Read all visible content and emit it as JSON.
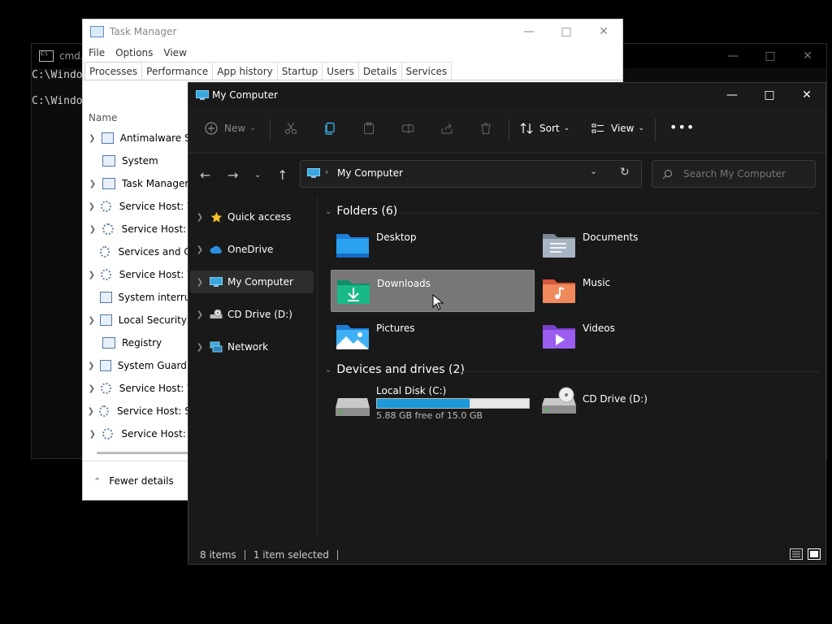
{
  "cmd": {
    "title": "cmd.e",
    "lines": [
      "C:\\Windo",
      "C:\\Windo"
    ]
  },
  "taskmgr": {
    "title": "Task Manager",
    "menu": [
      "File",
      "Options",
      "View"
    ],
    "tabs": [
      "Processes",
      "Performance",
      "App history",
      "Startup",
      "Users",
      "Details",
      "Services"
    ],
    "active_tab": "Processes",
    "column_name": "Name",
    "processes": [
      {
        "name": "Antimalware Se",
        "expand": true,
        "icon": "app-icon"
      },
      {
        "name": "System",
        "expand": false,
        "icon": "app-icon"
      },
      {
        "name": "Task Manager",
        "expand": true,
        "icon": "taskmgr-icon"
      },
      {
        "name": "Service Host: W",
        "expand": true,
        "icon": "gear-icon"
      },
      {
        "name": "Service Host: N",
        "expand": true,
        "icon": "gear-icon"
      },
      {
        "name": "Services and Co",
        "expand": false,
        "icon": "gear-icon"
      },
      {
        "name": "Service Host: W",
        "expand": true,
        "icon": "gear-icon"
      },
      {
        "name": "System interrup",
        "expand": false,
        "icon": "app-icon"
      },
      {
        "name": "Local Security A",
        "expand": true,
        "icon": "app-icon"
      },
      {
        "name": "Registry",
        "expand": false,
        "icon": "app-icon"
      },
      {
        "name": "System Guard R",
        "expand": true,
        "icon": "app-icon"
      },
      {
        "name": "Service Host: W",
        "expand": true,
        "icon": "gear-icon"
      },
      {
        "name": "Service Host: Sy",
        "expand": true,
        "icon": "gear-icon"
      },
      {
        "name": "Service Host: G",
        "expand": true,
        "icon": "gear-icon"
      }
    ],
    "fewer_details": "Fewer details"
  },
  "explorer": {
    "title": "My Computer",
    "toolbar": {
      "new_label": "New",
      "sort_label": "Sort",
      "view_label": "View"
    },
    "address": {
      "location": "My Computer",
      "search_placeholder": "Search My Computer"
    },
    "nav": [
      {
        "label": "Quick access",
        "icon": "star-icon",
        "selected": false
      },
      {
        "label": "OneDrive",
        "icon": "cloud-icon",
        "selected": false
      },
      {
        "label": "My Computer",
        "icon": "computer-icon",
        "selected": true
      },
      {
        "label": "CD Drive (D:)",
        "icon": "cd-drive-icon",
        "selected": false
      },
      {
        "label": "Network",
        "icon": "network-icon",
        "selected": false
      }
    ],
    "folders_header": "Folders (6)",
    "folders": [
      {
        "name": "Desktop",
        "icon": "desktop-folder-icon",
        "selected": false
      },
      {
        "name": "Documents",
        "icon": "documents-folder-icon",
        "selected": false
      },
      {
        "name": "Downloads",
        "icon": "downloads-folder-icon",
        "selected": true
      },
      {
        "name": "Music",
        "icon": "music-folder-icon",
        "selected": false
      },
      {
        "name": "Pictures",
        "icon": "pictures-folder-icon",
        "selected": false
      },
      {
        "name": "Videos",
        "icon": "videos-folder-icon",
        "selected": false
      }
    ],
    "drives_header": "Devices and drives (2)",
    "drives": [
      {
        "name": "Local Disk (C:)",
        "free_text": "5.88 GB free of 15.0 GB",
        "used_fraction": 0.608
      },
      {
        "name": "CD Drive (D:)"
      }
    ],
    "status": {
      "items": "8 items",
      "selected": "1 item selected"
    }
  },
  "colors": {
    "accent": "#1a9ad9",
    "explorer_bg": "#191919",
    "selection": "#777777"
  }
}
